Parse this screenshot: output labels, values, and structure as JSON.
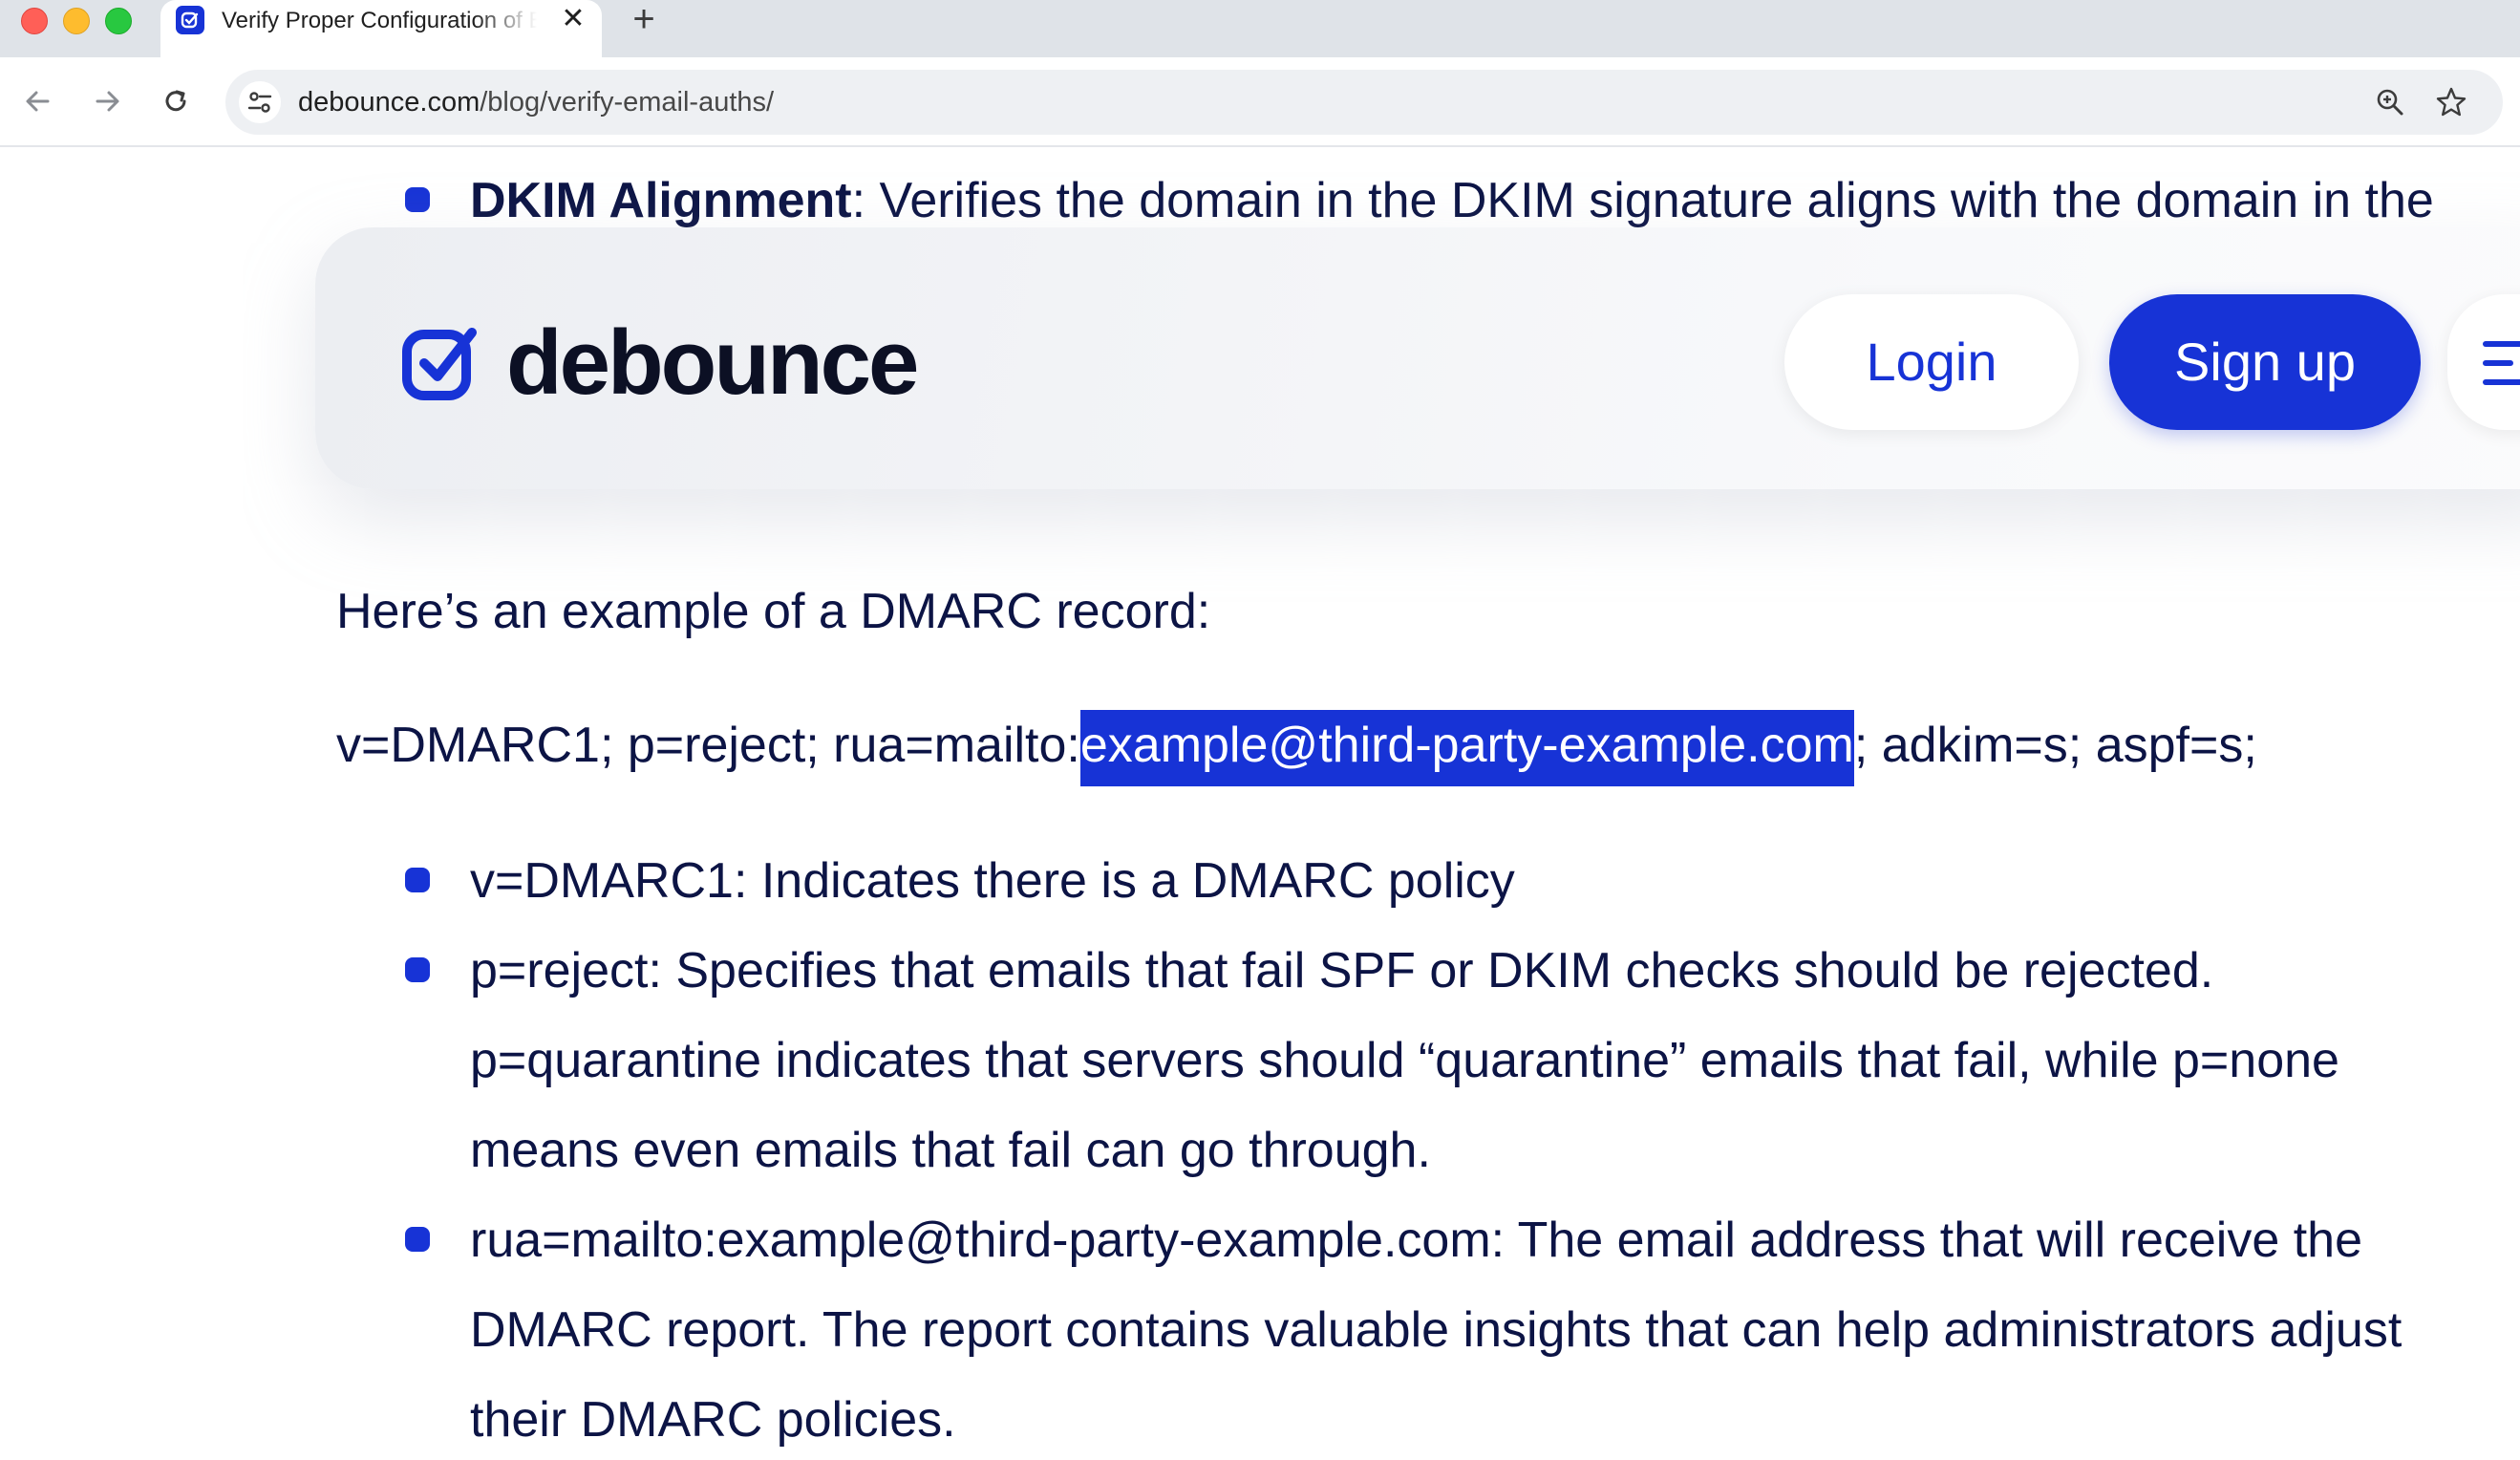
{
  "browser": {
    "tab_title": "Verify Proper Configuration of Email Authentication",
    "tab_close": "✕",
    "new_tab": "+",
    "url_host": "debounce.com",
    "url_path": "/blog/verify-email-auths/"
  },
  "header": {
    "logo_text": "debounce",
    "login_label": "Login",
    "signup_label": "Sign up"
  },
  "article": {
    "top_bullet_bold": "DKIM Alignment",
    "top_bullet_text": ": Verifies the domain in the DKIM signature aligns with the domain in the",
    "intro": "Here’s an example of a DMARC record:",
    "record_before": "v=DMARC1; p=reject; rua=mailto:",
    "record_selected": "example@third-party-example.com",
    "record_after": "; adkim=s; aspf=s;",
    "bullets": [
      {
        "lines": [
          "v=DMARC1: Indicates there is a DMARC policy"
        ]
      },
      {
        "lines": [
          "p=reject: Specifies that emails that fail SPF or DKIM checks should be rejected.",
          "p=quarantine indicates that servers should “quarantine” emails that fail, while p=none",
          "means even emails that fail can go through."
        ]
      },
      {
        "lines": [
          "rua=mailto:example@third-party-example.com: The email address that will receive the",
          "DMARC report. The report contains valuable insights that can help administrators adjust",
          "their DMARC policies."
        ]
      }
    ]
  },
  "colors": {
    "brand_blue": "#1733d6",
    "text_navy": "#0c1445"
  }
}
